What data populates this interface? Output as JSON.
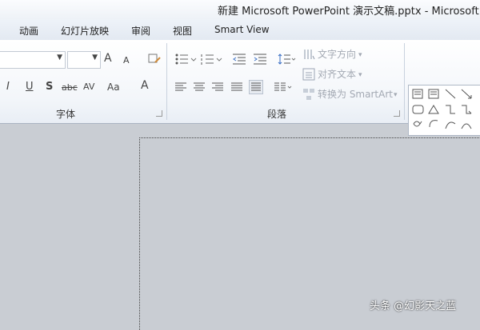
{
  "window": {
    "title": "新建 Microsoft PowerPoint 演示文稿.pptx  -  Microsoft Po"
  },
  "tabs": [
    "动画",
    "幻灯片放映",
    "审阅",
    "视图",
    "Smart View"
  ],
  "ribbon": {
    "groups": {
      "font": "字体",
      "paragraph": "段落"
    },
    "font_buttons": {
      "grow": "A",
      "shrink": "A",
      "italic": "I",
      "underline": "U",
      "shadow": "S",
      "strike": "abc",
      "spacing": "AV",
      "case": "Aa",
      "color": "A"
    },
    "paragraph_buttons": {
      "text_direction": "文字方向",
      "align_text": "对齐文本",
      "convert_smartart": "转换为 SmartArt"
    }
  },
  "watermark": "头条 @幻影天之蓝",
  "icons": [
    "bullets-icon",
    "numbering-icon",
    "decrease-indent-icon",
    "increase-indent-icon",
    "line-spacing-icon",
    "align-left-icon",
    "align-center-icon",
    "align-right-icon",
    "justify-icon",
    "distributed-icon",
    "columns-icon",
    "clear-format-icon",
    "shapes-gallery-icon"
  ]
}
